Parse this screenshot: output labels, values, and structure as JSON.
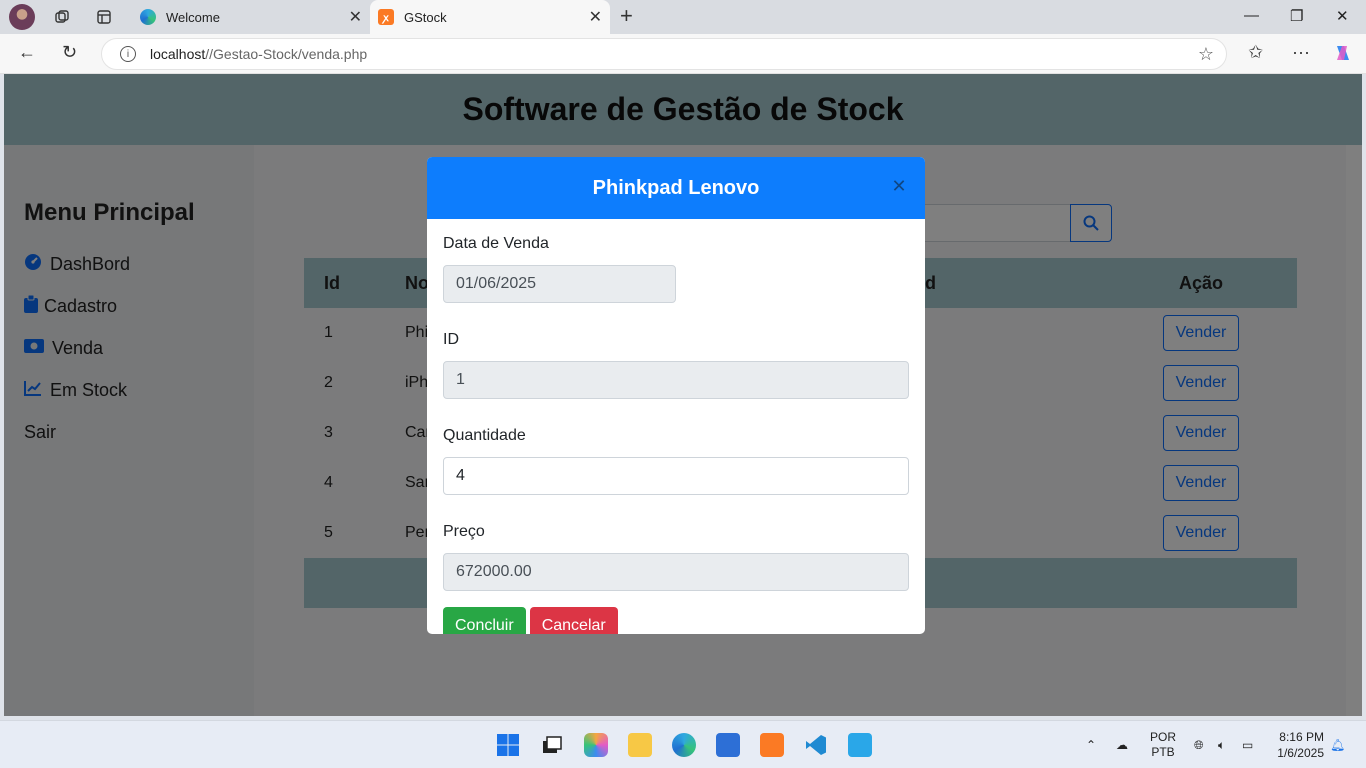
{
  "browser": {
    "tabs": [
      {
        "title": "Welcome",
        "active": false
      },
      {
        "title": "GStock",
        "active": true
      }
    ],
    "url_host": "localhost",
    "url_path": "//Gestao-Stock/venda.php"
  },
  "page": {
    "title": "Software de Gestão de Stock",
    "sidebar": {
      "heading": "Menu Principal",
      "items": [
        {
          "label": "DashBord",
          "icon": "gauge-icon"
        },
        {
          "label": "Cadastro",
          "icon": "clipboard-icon"
        },
        {
          "label": "Venda",
          "icon": "money-icon"
        },
        {
          "label": "Em Stock",
          "icon": "chart-line-icon"
        },
        {
          "label": "Sair",
          "icon": ""
        }
      ]
    },
    "table": {
      "headers": [
        "Id",
        "No",
        "d",
        "Ação"
      ],
      "rows": [
        {
          "id": "1",
          "name": "Phi",
          "action": "Vender"
        },
        {
          "id": "2",
          "name": "iPh",
          "action": "Vender"
        },
        {
          "id": "3",
          "name": "Car",
          "action": "Vender"
        },
        {
          "id": "4",
          "name": "Sar",
          "action": "Vender"
        },
        {
          "id": "5",
          "name": "Per",
          "action": "Vender"
        }
      ]
    }
  },
  "modal": {
    "title": "Phinkpad Lenovo",
    "fields": {
      "date_label": "Data de Venda",
      "date_value": "01/06/2025",
      "id_label": "ID",
      "id_value": "1",
      "qty_label": "Quantidade",
      "qty_value": "4",
      "price_label": "Preço",
      "price_value": "672000.00"
    },
    "confirm_label": "Concluir",
    "cancel_label": "Cancelar"
  },
  "taskbar": {
    "lang_top": "POR",
    "lang_bottom": "PTB",
    "time": "8:16 PM",
    "date": "1/6/2025"
  },
  "colors": {
    "header_bg": "#a6cad0",
    "modal_header": "#0d7dfd",
    "primary": "#0d6efd",
    "success": "#28a745",
    "danger": "#dc3545"
  }
}
